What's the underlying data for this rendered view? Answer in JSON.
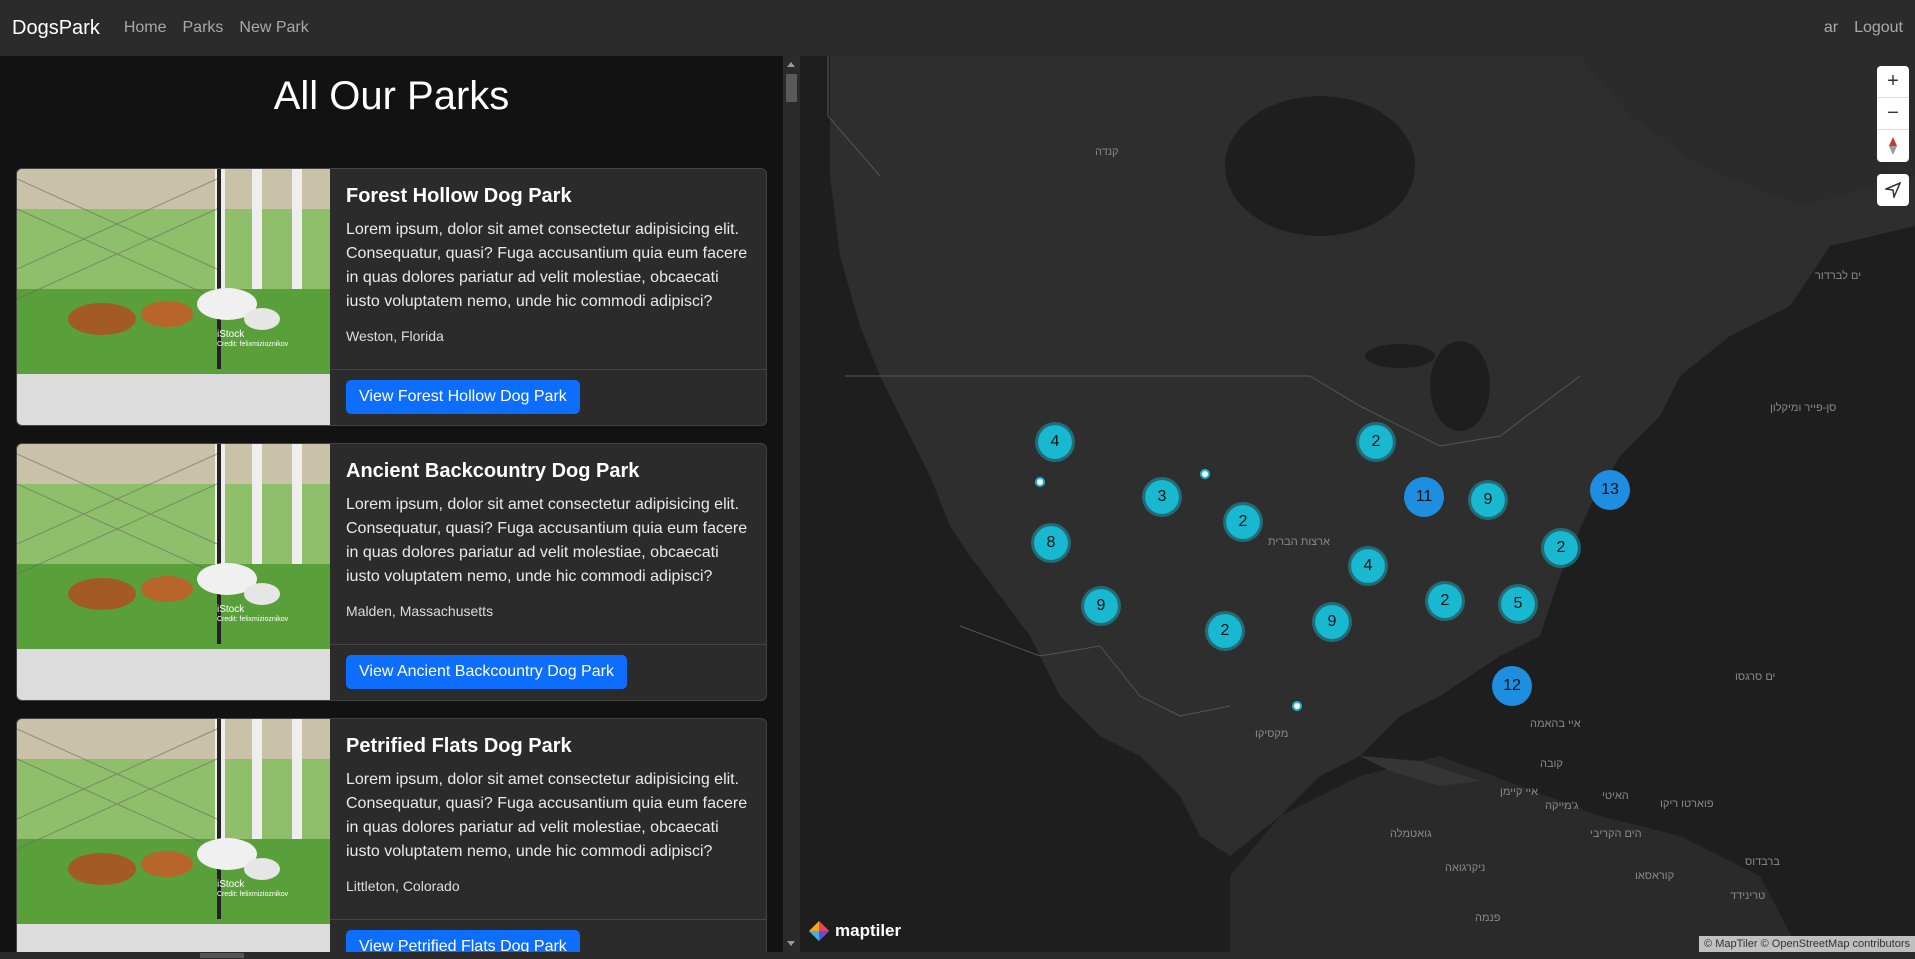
{
  "nav": {
    "brand": "DogsPark",
    "links": [
      "Home",
      "Parks",
      "New Park"
    ],
    "user": "ar",
    "logout": "Logout"
  },
  "page": {
    "title": "All Our Parks"
  },
  "parks": [
    {
      "title": "Forest Hollow Dog Park",
      "description": "Lorem ipsum, dolor sit amet consectetur adipisicing elit. Consequatur, quasi? Fuga accusantium quia eum facere in quas dolores pariatur ad velit molestiae, obcaecati iusto voluptatem nemo, unde hic commodi adipisci?",
      "location": "Weston, Florida",
      "button": "View Forest Hollow Dog Park",
      "image_caption": "iStock",
      "image_credit": "Credit: felixmizioznikov"
    },
    {
      "title": "Ancient Backcountry Dog Park",
      "description": "Lorem ipsum, dolor sit amet consectetur adipisicing elit. Consequatur, quasi? Fuga accusantium quia eum facere in quas dolores pariatur ad velit molestiae, obcaecati iusto voluptatem nemo, unde hic commodi adipisci?",
      "location": "Malden, Massachusetts",
      "button": "View Ancient Backcountry Dog Park",
      "image_caption": "iStock",
      "image_credit": "Credit: felixmizioznikov"
    },
    {
      "title": "Petrified Flats Dog Park",
      "description": "Lorem ipsum, dolor sit amet consectetur adipisicing elit. Consequatur, quasi? Fuga accusantium quia eum facere in quas dolores pariatur ad velit molestiae, obcaecati iusto voluptatem nemo, unde hic commodi adipisci?",
      "location": "Littleton, Colorado",
      "button": "View Petrified Flats Dog Park",
      "image_caption": "iStock",
      "image_credit": "Credit: felixmizioznikov"
    }
  ],
  "map": {
    "clusters": [
      "4",
      "2",
      "3",
      "2",
      "11",
      "9",
      "13",
      "8",
      "2",
      "4",
      "2",
      "5",
      "9",
      "2",
      "9",
      "12"
    ],
    "labels": [
      "קנדה",
      "ארצות הברית",
      "מקסיקו",
      "ים לברדור",
      "סן-פייר ומיקלון",
      "ים סרגסו",
      "איי בהאמה",
      "קובה",
      "איי קיימן",
      "ג'מייקה",
      "האיטי",
      "פוארטו ריקו",
      "הים הקריבי",
      "גואטמלה",
      "ניקרגואה",
      "קוראסאו",
      "ברבדוס",
      "טרינידד",
      "פנמה"
    ],
    "brand": "maptiler",
    "attribution": "© MapTiler © OpenStreetMap contributors",
    "zoom_in": "+",
    "zoom_out": "−"
  }
}
